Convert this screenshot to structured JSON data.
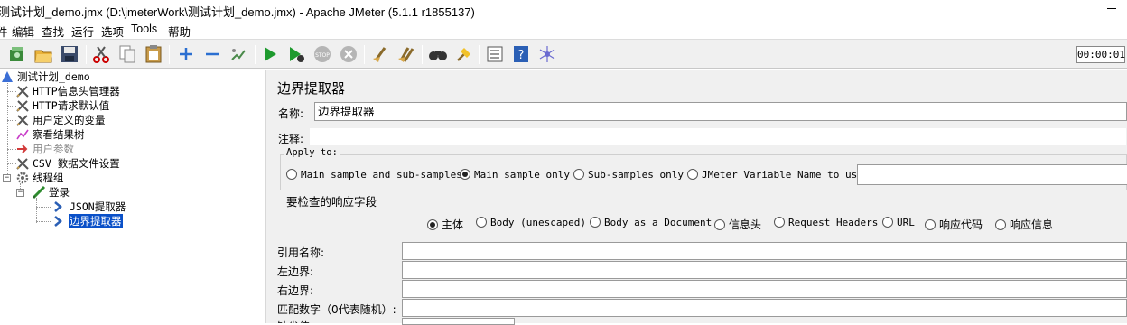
{
  "window": {
    "title": "测试计划_demo.jmx (D:\\jmeterWork\\测试计划_demo.jmx) - Apache JMeter (5.1.1 r1855137)"
  },
  "menu": {
    "items": [
      "件",
      "编辑",
      "查找",
      "运行",
      "选项",
      "Tools",
      "帮助"
    ]
  },
  "toolbar": {
    "icons": [
      "templates-icon",
      "open-icon",
      "save-icon",
      "cut-icon",
      "copy-icon",
      "paste-icon",
      "expand-icon",
      "collapse-icon",
      "toggle-icon",
      "start-icon",
      "start-no-pause-icon",
      "stop-icon",
      "shutdown-icon",
      "clear-icon",
      "clear-all-icon",
      "search-icon",
      "reset-search-icon",
      "function-helper-icon",
      "help-icon",
      "remote-icon"
    ],
    "timer": "00:00:01"
  },
  "tree": {
    "nodes": [
      {
        "label": "测试计划_demo",
        "icon": "test-plan-icon",
        "state": "normal"
      },
      {
        "label": "HTTP信息头管理器",
        "icon": "config-tools-icon",
        "state": "normal"
      },
      {
        "label": "HTTP请求默认值",
        "icon": "config-tools-icon",
        "state": "normal"
      },
      {
        "label": "用户定义的变量",
        "icon": "config-tools-icon",
        "state": "normal"
      },
      {
        "label": "察看结果树",
        "icon": "listener-icon",
        "state": "normal"
      },
      {
        "label": "用户参数",
        "icon": "preprocessor-icon",
        "state": "disabled"
      },
      {
        "label": "CSV 数据文件设置",
        "icon": "config-tools-icon",
        "state": "normal"
      },
      {
        "label": "线程组",
        "icon": "thread-group-gear-icon",
        "state": "normal"
      },
      {
        "label": "登录",
        "icon": "sampler-pen-icon",
        "state": "normal"
      },
      {
        "label": "JSON提取器",
        "icon": "extractor-arrow-icon",
        "state": "normal"
      },
      {
        "label": "边界提取器",
        "icon": "extractor-arrow-icon",
        "state": "selected"
      }
    ]
  },
  "panel": {
    "title": "边界提取器",
    "name_label": "名称:",
    "name_value": "边界提取器",
    "comment_label": "注释:",
    "apply_to": {
      "title": "Apply to:",
      "options": [
        "Main sample and sub-samples",
        "Main sample only",
        "Sub-samples only",
        "JMeter Variable Name to use"
      ],
      "selected": "Main sample only"
    },
    "field_check": {
      "title": "要检查的响应字段",
      "options": [
        "主体",
        "Body (unescaped)",
        "Body as a Document",
        "信息头",
        "Request Headers",
        "URL",
        "响应代码",
        "响应信息"
      ],
      "selected": "主体"
    },
    "fields": {
      "ref_name": "引用名称:",
      "left_boundary": "左边界:",
      "right_boundary": "右边界:",
      "match_no": "匹配数字（0代表随机）:",
      "default_value": "缺省值"
    }
  },
  "colors": {
    "selection": "#0a50c8",
    "panel_bg": "#f0f0f0"
  }
}
